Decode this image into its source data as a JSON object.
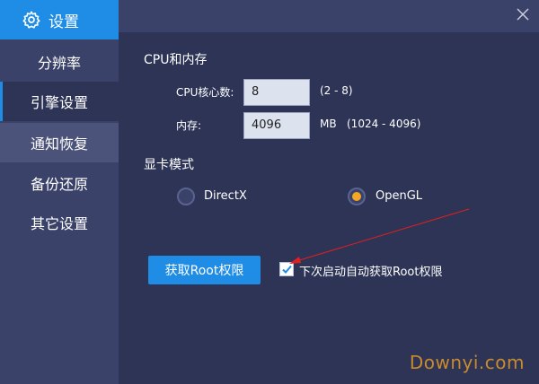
{
  "sidebar": {
    "title": "设置",
    "items": [
      {
        "label": "分辨率"
      },
      {
        "label": "引擎设置"
      },
      {
        "label": "通知恢复"
      },
      {
        "label": "备份还原"
      },
      {
        "label": "其它设置"
      }
    ]
  },
  "cpu_memory": {
    "title": "CPU和内存",
    "cpu_label": "CPU核心数:",
    "cpu_value": "8",
    "cpu_range": "(2 - 8)",
    "mem_label": "内存:",
    "mem_value": "4096",
    "mem_unit": "MB",
    "mem_range": "(1024 - 4096)"
  },
  "graphics": {
    "title": "显卡模式",
    "options": [
      {
        "label": "DirectX",
        "selected": false
      },
      {
        "label": "OpenGL",
        "selected": true
      }
    ]
  },
  "root": {
    "button_label": "获取Root权限",
    "checkbox_label": "下次启动自动获取Root权限",
    "checkbox_checked": true
  },
  "watermark": "Downyi.com",
  "colors": {
    "accent": "#1f8ce6",
    "radio_selected": "#f5a623",
    "background": "#2d3456",
    "sidebar": "#3b4269"
  },
  "icons": {
    "header": "gear-icon",
    "close": "close-icon",
    "checkbox": "checkmark-icon"
  }
}
